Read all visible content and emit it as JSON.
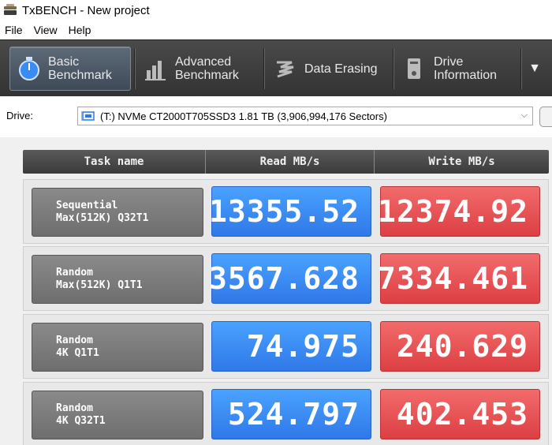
{
  "window": {
    "title": "TxBENCH - New project"
  },
  "menu": [
    "File",
    "View",
    "Help"
  ],
  "toolbar": {
    "tabs": [
      {
        "line1": "Basic",
        "line2": "Benchmark",
        "icon": "stopwatch-icon"
      },
      {
        "line1": "Advanced",
        "line2": "Benchmark",
        "icon": "bar-chart-icon"
      },
      {
        "line1": "Data Erasing",
        "line2": "",
        "icon": "eraser-icon"
      },
      {
        "line1": "Drive",
        "line2": "Information",
        "icon": "drive-info-icon"
      }
    ],
    "more_glyph": "▼"
  },
  "drive": {
    "label": "Drive:",
    "selected": "(T:) NVMe CT2000T705SSD3  1.81 TB (3,906,994,176 Sectors)",
    "chevron": "⌵"
  },
  "table": {
    "headers": [
      "Task name",
      "Read MB/s",
      "Write MB/s"
    ],
    "rows": [
      {
        "line1": "Sequential",
        "line2": "Max(512K) Q32T1",
        "read": "13355.52",
        "write": "12374.92"
      },
      {
        "line1": "Random",
        "line2": "Max(512K) Q1T1",
        "read": "3567.628",
        "write": "7334.461"
      },
      {
        "line1": "Random",
        "line2": "4K Q1T1",
        "read": "74.975",
        "write": "240.629"
      },
      {
        "line1": "Random",
        "line2": "4K Q32T1",
        "read": "524.797",
        "write": "402.453"
      }
    ]
  },
  "colors": {
    "read": "#3a8cf5",
    "write": "#e5484d",
    "toolbar": "#3d3d3d"
  }
}
